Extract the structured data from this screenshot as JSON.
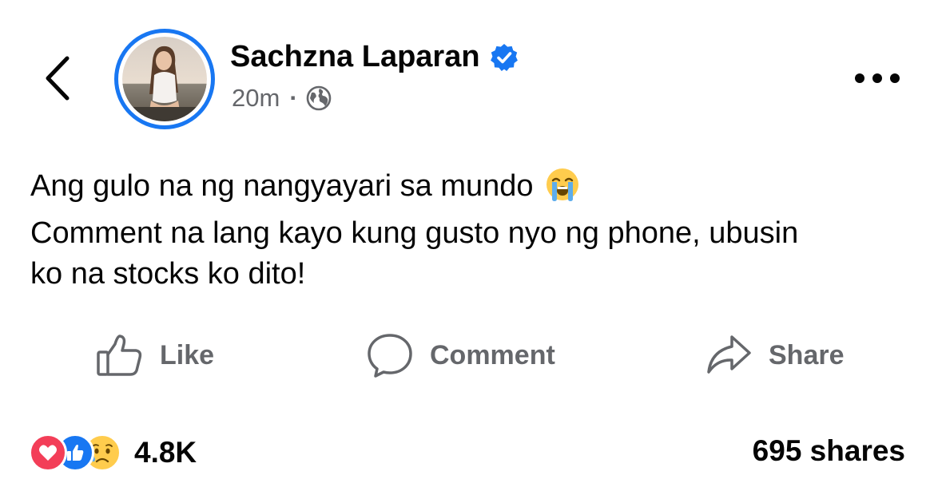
{
  "header": {
    "back_icon": "chevron-left-icon",
    "more_icon": "more-horizontal-icon"
  },
  "author": {
    "name": "Sachzna Laparan",
    "verified": true,
    "verified_color": "#1877f2",
    "avatar_ring_color": "#1877f2"
  },
  "meta": {
    "time": "20m",
    "separator": "·",
    "audience_icon": "globe-icon"
  },
  "post": {
    "line1": "Ang gulo na ng nangyayari sa mundo",
    "line1_emoji": "loudly-crying-face-emoji",
    "line2": "Comment na lang kayo kung gusto nyo ng phone, ubusin",
    "line3": "ko na stocks ko dito!"
  },
  "actions": {
    "like_label": "Like",
    "comment_label": "Comment",
    "share_label": "Share"
  },
  "stats": {
    "reactions": [
      "love",
      "like",
      "sad"
    ],
    "reaction_count": "4.8K",
    "shares": "695 shares"
  },
  "colors": {
    "brand_blue": "#1877f2",
    "love_red": "#f33e58",
    "muted_text": "#65676b",
    "primary_text": "#050505"
  }
}
